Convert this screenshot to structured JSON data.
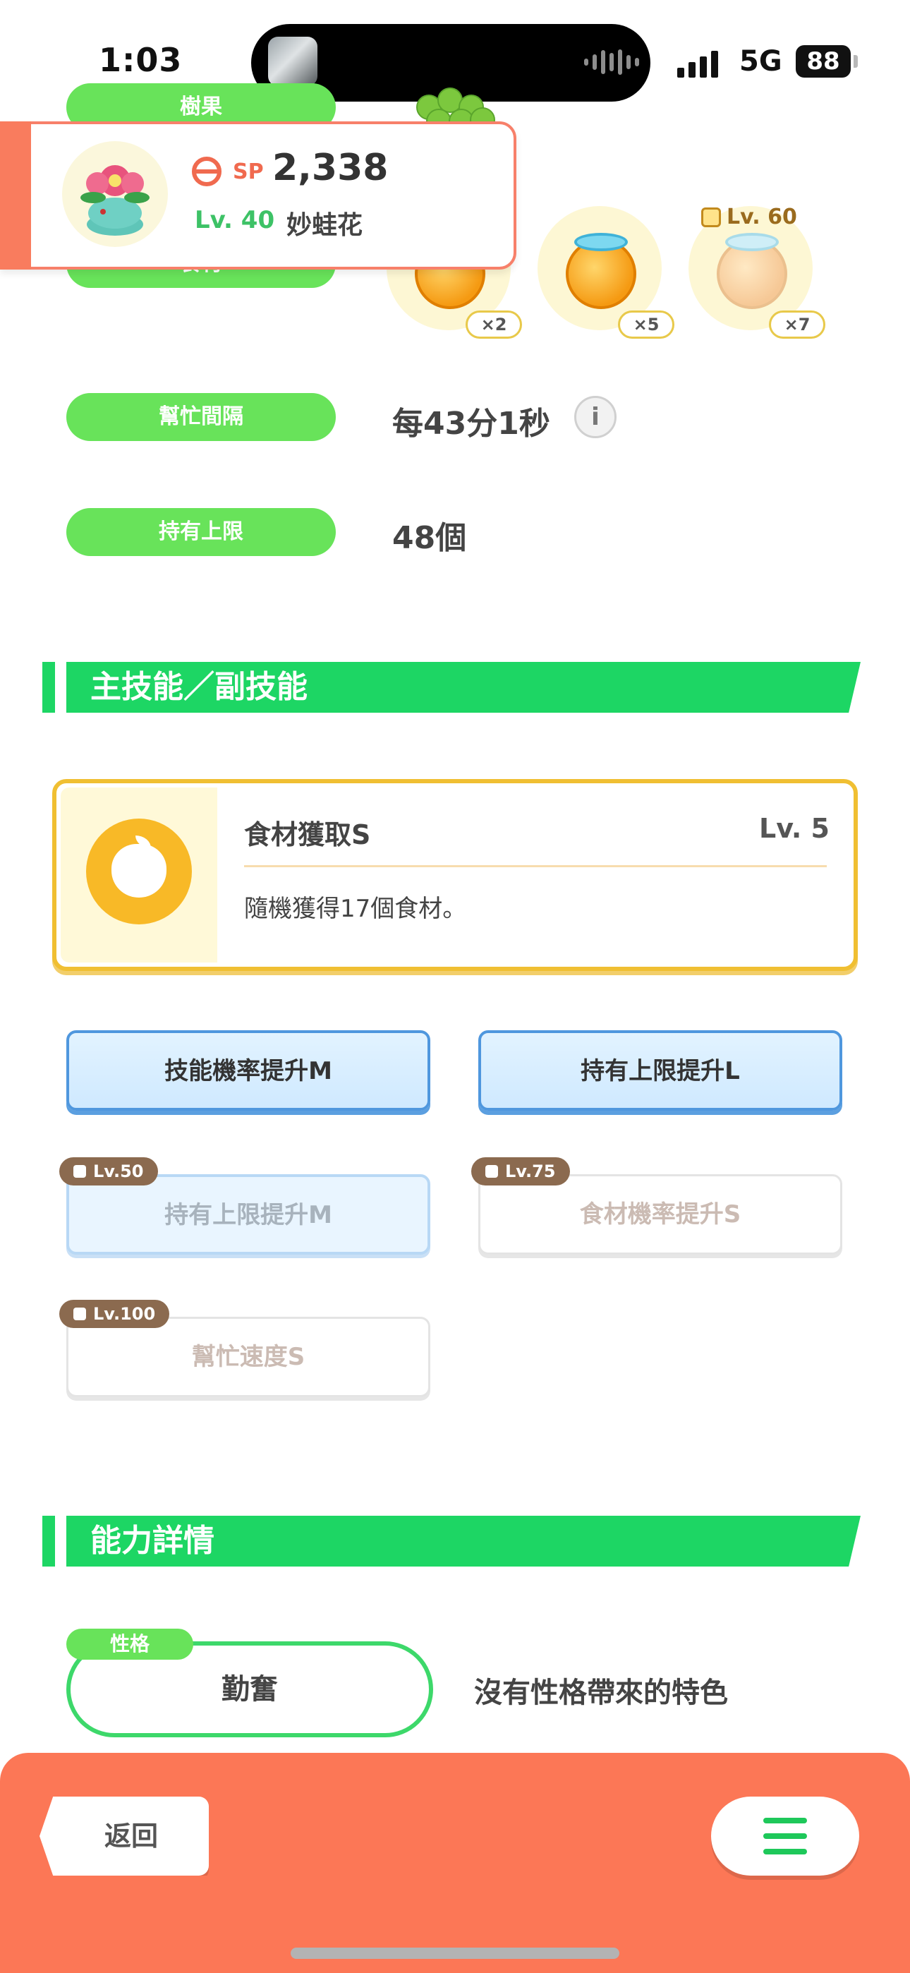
{
  "status_bar": {
    "time": "1:03",
    "network": "5G",
    "battery": "88"
  },
  "pokemon": {
    "sp_label": "SP",
    "sp_value": "2,338",
    "level": "Lv. 40",
    "name": "妙蛙花"
  },
  "stats": {
    "berry_label": "樹果",
    "ingredient_label": "食材",
    "ingredients": [
      {
        "qty": "×2",
        "locked": false
      },
      {
        "qty": "×5",
        "locked": false
      },
      {
        "qty": "×7",
        "locked": true,
        "lock_level": "Lv. 60"
      }
    ],
    "help_interval": {
      "label": "幫忙間隔",
      "value": "每43分1秒"
    },
    "carry_limit": {
      "label": "持有上限",
      "value": "48個"
    }
  },
  "skills_section": {
    "title": "主技能／副技能",
    "main_skill": {
      "name": "食材獲取S",
      "level": "Lv. 5",
      "description": "隨機獲得17個食材。"
    },
    "sub_skills": [
      {
        "label": "技能機率提升M",
        "style": "blue"
      },
      {
        "label": "持有上限提升L",
        "style": "blue"
      },
      {
        "label": "持有上限提升M",
        "style": "blue-dim",
        "lock_level": "Lv.50"
      },
      {
        "label": "食材機率提升S",
        "style": "white-dim",
        "lock_level": "Lv.75"
      },
      {
        "label": "幫忙速度S",
        "style": "white-dim",
        "lock_level": "Lv.100"
      }
    ]
  },
  "ability_section": {
    "title": "能力詳情",
    "nature_label": "性格",
    "nature_value": "勤奮",
    "nature_desc": "沒有性格帶來的特色"
  },
  "bottom_bar": {
    "back_label": "返回",
    "menu_icon": "hamburger-icon"
  },
  "colors": {
    "accent_green": "#1dd664",
    "pill_green": "#68e35a",
    "bottom_bar": "#fc7756",
    "gold": "#f0bf32",
    "blue": "#4f97de"
  }
}
